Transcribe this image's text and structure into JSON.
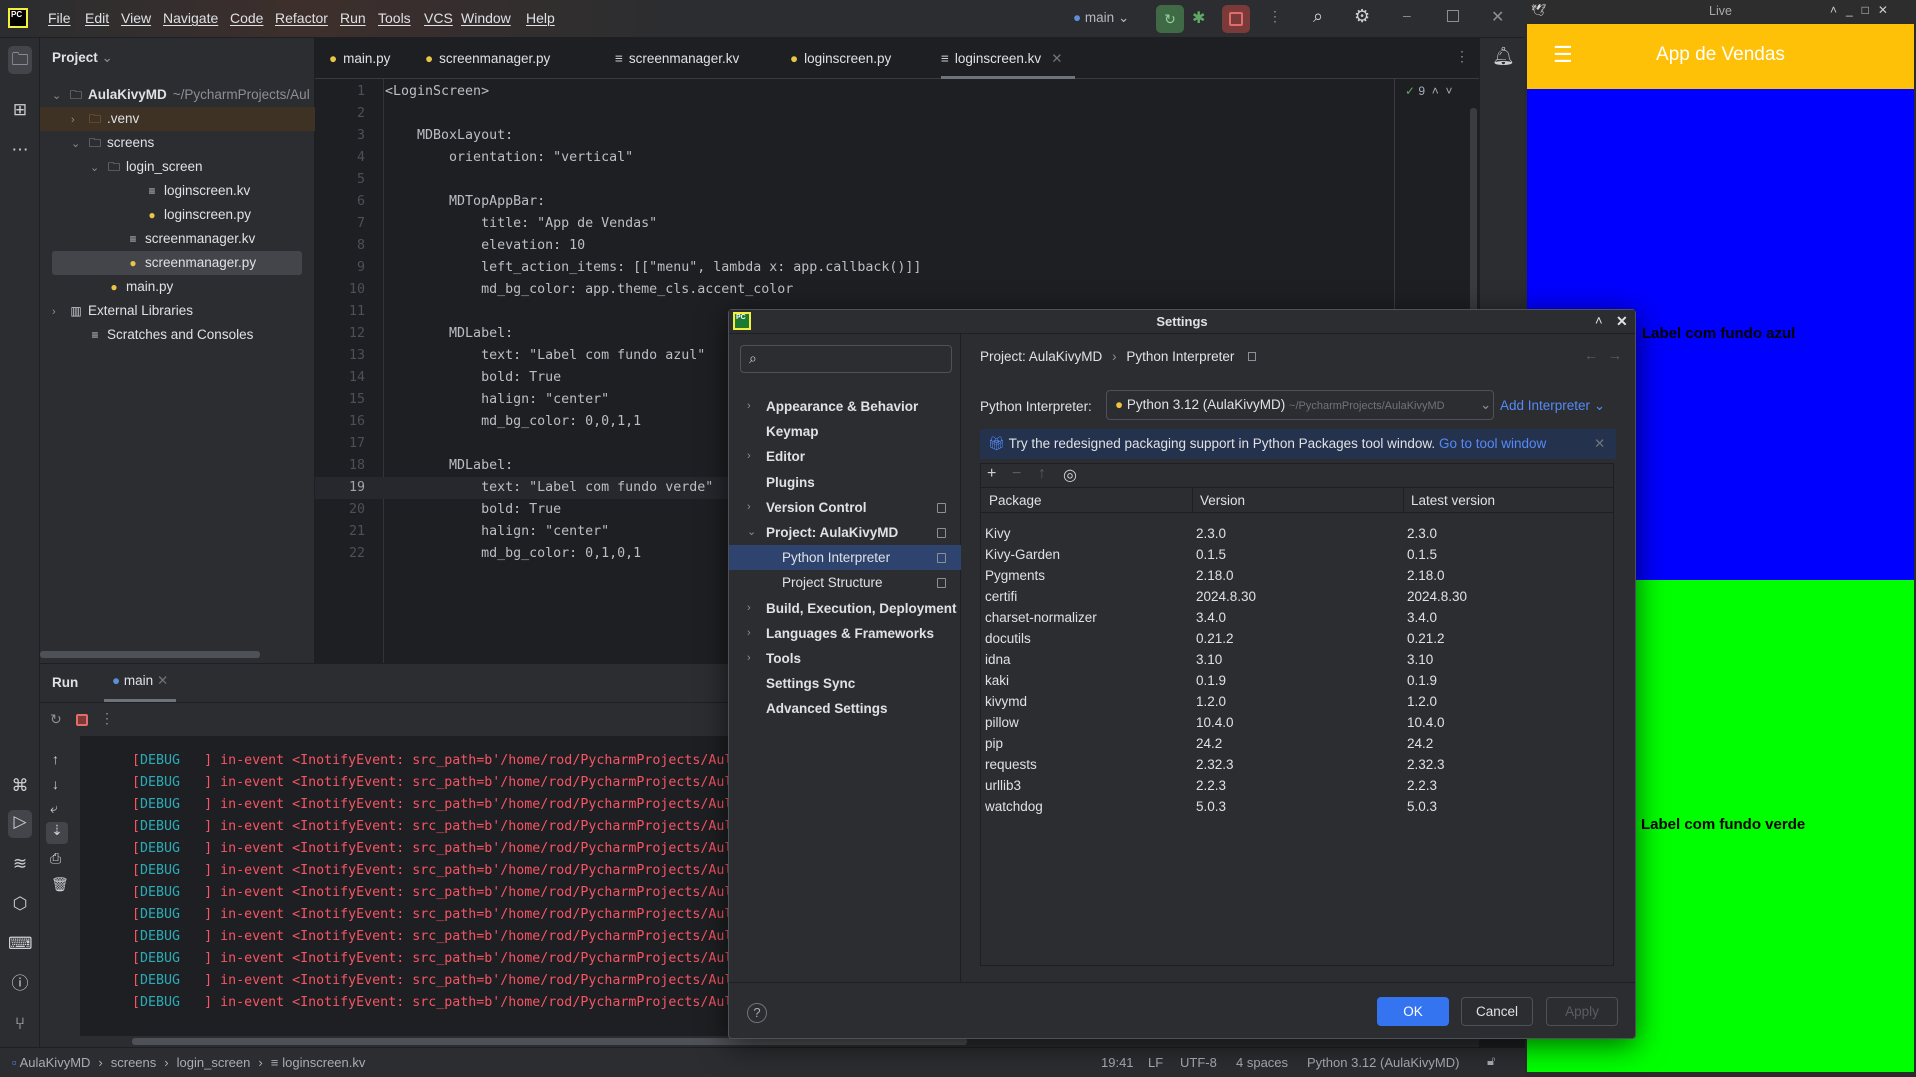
{
  "menubar": {
    "items": [
      "File",
      "Edit",
      "View",
      "Navigate",
      "Code",
      "Refactor",
      "Run",
      "Tools",
      "VCS",
      "Window",
      "Help"
    ],
    "branch": "main"
  },
  "project_panel": {
    "title": "Project",
    "tree": [
      {
        "label": "AulaKivyMD",
        "hint": "~/PycharmProjects/Aul",
        "level": 0,
        "icon": "folder-icon",
        "chevron": "v",
        "bold": true
      },
      {
        "label": ".venv",
        "level": 1,
        "icon": "folder-icon",
        "chevron": ">",
        "excluded": true
      },
      {
        "label": "screens",
        "level": 1,
        "icon": "folder-icon",
        "chevron": "v"
      },
      {
        "label": "login_screen",
        "level": 2,
        "icon": "folder-icon",
        "chevron": "v"
      },
      {
        "label": "loginscreen.kv",
        "level": 4,
        "icon": "kv-file-icon"
      },
      {
        "label": "loginscreen.py",
        "level": 4,
        "icon": "python-file-icon"
      },
      {
        "label": "screenmanager.kv",
        "level": 3,
        "icon": "kv-file-icon"
      },
      {
        "label": "screenmanager.py",
        "level": 3,
        "icon": "python-file-icon",
        "selected": true
      },
      {
        "label": "main.py",
        "level": 2,
        "icon": "python-file-icon"
      },
      {
        "label": "External Libraries",
        "level": 0,
        "icon": "library-icon",
        "chevron": ">"
      },
      {
        "label": "Scratches and Consoles",
        "level": 1,
        "icon": "scratches-icon"
      }
    ]
  },
  "editor": {
    "tabs": [
      {
        "label": "main.py",
        "icon": "python-file-icon"
      },
      {
        "label": "screenmanager.py",
        "icon": "python-file-icon"
      },
      {
        "label": "screenmanager.kv",
        "icon": "kv-file-icon"
      },
      {
        "label": "loginscreen.py",
        "icon": "python-file-icon"
      },
      {
        "label": "loginscreen.kv",
        "icon": "kv-file-icon",
        "active": true
      }
    ],
    "inspection_count": "9",
    "current_line": 19,
    "lines": [
      "<LoginScreen>",
      "",
      "    MDBoxLayout:",
      "        orientation: \"vertical\"",
      "",
      "        MDTopAppBar:",
      "            title: \"App de Vendas\"",
      "            elevation: 10",
      "            left_action_items: [[\"menu\", lambda x: app.callback()]]",
      "            md_bg_color: app.theme_cls.accent_color",
      "",
      "        MDLabel:",
      "            text: \"Label com fundo azul\"",
      "            bold: True",
      "            halign: \"center\"",
      "            md_bg_color: 0,0,1,1",
      "",
      "        MDLabel:",
      "            text: \"Label com fundo verde\"",
      "            bold: True",
      "            halign: \"center\"",
      "            md_bg_color: 0,1,0,1"
    ]
  },
  "run_panel": {
    "title": "Run",
    "tab": "main",
    "log_level": "DEBUG",
    "log_lines": [
      "in-event <InotifyEvent: src_path=b'/home/rod/PycharmProjects/AulaKivyM",
      "in-event <InotifyEvent: src_path=b'/home/rod/PycharmProjects/AulaKivyM",
      "in-event <InotifyEvent: src_path=b'/home/rod/PycharmProjects/AulaKivyM",
      "in-event <InotifyEvent: src_path=b'/home/rod/PycharmProjects/AulaKivyM",
      "in-event <InotifyEvent: src_path=b'/home/rod/PycharmProjects/AulaKivyM",
      "in-event <InotifyEvent: src_path=b'/home/rod/PycharmProjects/AulaKivyM",
      "in-event <InotifyEvent: src_path=b'/home/rod/PycharmProjects/AulaKivyM",
      "in-event <InotifyEvent: src_path=b'/home/rod/PycharmProjects/AulaKivyM",
      "in-event <InotifyEvent: src_path=b'/home/rod/PycharmProjects/AulaKivyM",
      "in-event <InotifyEvent: src_path=b'/home/rod/PycharmProjects/AulaKivyM",
      "in-event <InotifyEvent: src_path=b'/home/rod/PycharmProjects/AulaKivyM",
      "in-event <InotifyEvent: src_path=b'/home/rod/PycharmProjects/AulaKivyM"
    ]
  },
  "status_bar": {
    "breadcrumb": [
      "AulaKivyMD",
      "screens",
      "login_screen",
      "loginscreen.kv"
    ],
    "position": "19:41",
    "line_sep": "LF",
    "encoding": "UTF-8",
    "indent": "4 spaces",
    "interpreter": "Python 3.12 (AulaKivyMD)"
  },
  "settings": {
    "title": "Settings",
    "search_placeholder": "",
    "nav": [
      {
        "label": "Appearance & Behavior",
        "chevron": ">"
      },
      {
        "label": "Keymap"
      },
      {
        "label": "Editor",
        "chevron": ">"
      },
      {
        "label": "Plugins"
      },
      {
        "label": "Version Control",
        "chevron": ">",
        "pin": true
      },
      {
        "label": "Project: AulaKivyMD",
        "chevron": "v",
        "pin": true
      },
      {
        "label": "Python Interpreter",
        "child": true,
        "pin": true,
        "selected": true
      },
      {
        "label": "Project Structure",
        "child": true,
        "pin": true
      },
      {
        "label": "Build, Execution, Deployment",
        "chevron": ">"
      },
      {
        "label": "Languages & Frameworks",
        "chevron": ">"
      },
      {
        "label": "Tools",
        "chevron": ">"
      },
      {
        "label": "Settings Sync"
      },
      {
        "label": "Advanced Settings"
      }
    ],
    "breadcrumb": [
      "Project: AulaKivyMD",
      "Python Interpreter"
    ],
    "interpreter_label": "Python Interpreter:",
    "interpreter_value": "Python 3.12 (AulaKivyMD)",
    "interpreter_path": "~/PycharmProjects/AulaKivyMD",
    "add_interpreter": "Add Interpreter",
    "banner_text": "Try the redesigned packaging support in Python Packages tool window.",
    "banner_link": "Go to tool window",
    "columns": [
      "Package",
      "Version",
      "Latest version"
    ],
    "packages": [
      [
        "Kivy",
        "2.3.0",
        "2.3.0"
      ],
      [
        "Kivy-Garden",
        "0.1.5",
        "0.1.5"
      ],
      [
        "Pygments",
        "2.18.0",
        "2.18.0"
      ],
      [
        "certifi",
        "2024.8.30",
        "2024.8.30"
      ],
      [
        "charset-normalizer",
        "3.4.0",
        "3.4.0"
      ],
      [
        "docutils",
        "0.21.2",
        "0.21.2"
      ],
      [
        "idna",
        "3.10",
        "3.10"
      ],
      [
        "kaki",
        "0.1.9",
        "0.1.9"
      ],
      [
        "kivymd",
        "1.2.0",
        "1.2.0"
      ],
      [
        "pillow",
        "10.4.0",
        "10.4.0"
      ],
      [
        "pip",
        "24.2",
        "24.2"
      ],
      [
        "requests",
        "2.32.3",
        "2.32.3"
      ],
      [
        "urllib3",
        "2.2.3",
        "2.2.3"
      ],
      [
        "watchdog",
        "5.0.3",
        "5.0.3"
      ]
    ],
    "ok": "OK",
    "cancel": "Cancel",
    "apply": "Apply",
    "help": "?"
  },
  "live_window": {
    "title": "Live",
    "app_title": "App de Vendas",
    "label_blue": "Label com fundo azul",
    "label_green": "Label com fundo verde",
    "colors": {
      "appbar": "#ffc107",
      "blue": "#0000ff",
      "green": "#00ff00"
    }
  }
}
